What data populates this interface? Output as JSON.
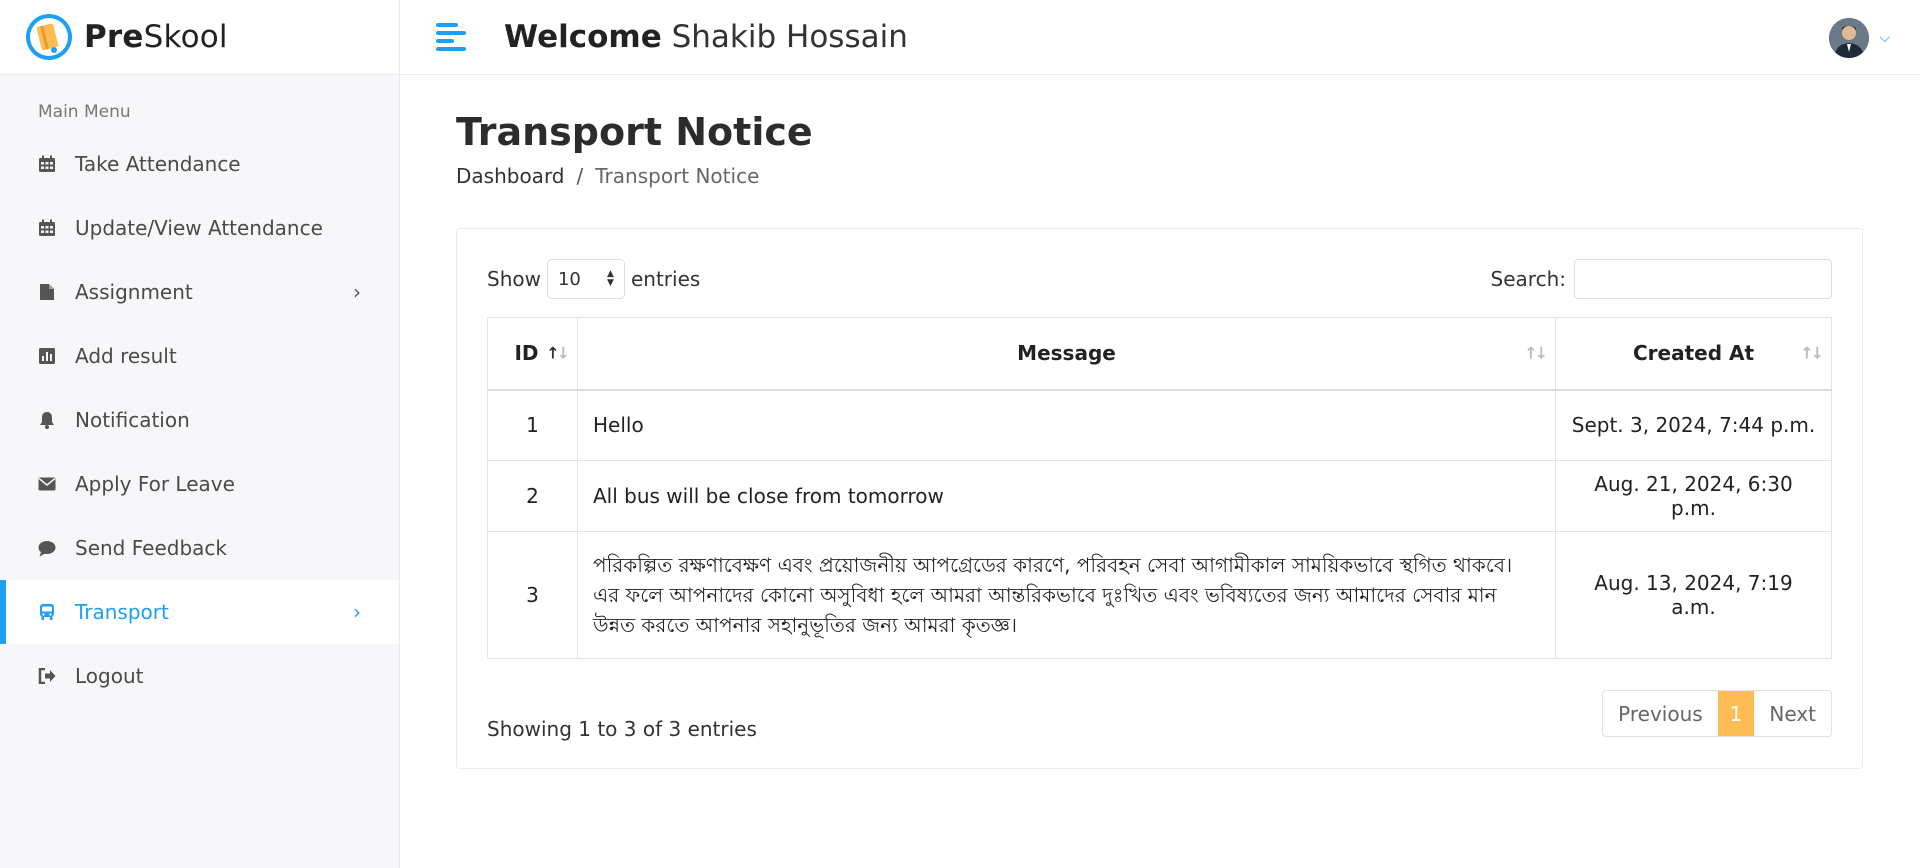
{
  "brand": {
    "name_bold": "Pre",
    "name_rest": "Skool"
  },
  "header": {
    "welcome_bold": "Welcome",
    "user_name": "Shakib Hossain"
  },
  "sidebar": {
    "section_title": "Main Menu",
    "items": [
      {
        "label": "Take Attendance",
        "icon": "calendar-icon"
      },
      {
        "label": "Update/View Attendance",
        "icon": "calendar-icon"
      },
      {
        "label": "Assignment",
        "icon": "file-icon",
        "has_submenu": true
      },
      {
        "label": "Add result",
        "icon": "chart-icon"
      },
      {
        "label": "Notification",
        "icon": "bell-icon"
      },
      {
        "label": "Apply For Leave",
        "icon": "envelope-icon"
      },
      {
        "label": "Send Feedback",
        "icon": "comment-icon"
      },
      {
        "label": "Transport",
        "icon": "bus-icon",
        "has_submenu": true,
        "active": true
      },
      {
        "label": "Logout",
        "icon": "logout-icon"
      }
    ]
  },
  "page": {
    "title": "Transport Notice",
    "breadcrumb": {
      "root": "Dashboard",
      "separator": "/",
      "current": "Transport Notice"
    }
  },
  "table": {
    "show_label": "Show",
    "entries_label": "entries",
    "page_size": "10",
    "search_label": "Search:",
    "columns": {
      "id": "ID",
      "message": "Message",
      "created_at": "Created At"
    },
    "rows": [
      {
        "id": "1",
        "message": "Hello",
        "created_at": "Sept. 3, 2024, 7:44 p.m."
      },
      {
        "id": "2",
        "message": "All bus will be close from tomorrow",
        "created_at": "Aug. 21, 2024, 6:30 p.m."
      },
      {
        "id": "3",
        "message": "পরিকল্পিত রক্ষণাবেক্ষণ এবং প্রয়োজনীয় আপগ্রেডের কারণে, পরিবহন সেবা আগামীকাল সাময়িকভাবে স্থগিত থাকবে। এর ফলে আপনাদের কোনো অসুবিধা হলে আমরা আন্তরিকভাবে দুঃখিত এবং ভবিষ্যতের জন্য আমাদের সেবার মান উন্নত করতে আপনার সহানুভূতির জন্য আমরা কৃতজ্ঞ।",
        "created_at": "Aug. 13, 2024, 7:19 a.m."
      }
    ],
    "info": "Showing 1 to 3 of 3 entries",
    "pagination": {
      "previous": "Previous",
      "current": "1",
      "next": "Next"
    }
  },
  "colors": {
    "accent": "#1e9ff2",
    "pagination_active": "#ffbc53"
  }
}
